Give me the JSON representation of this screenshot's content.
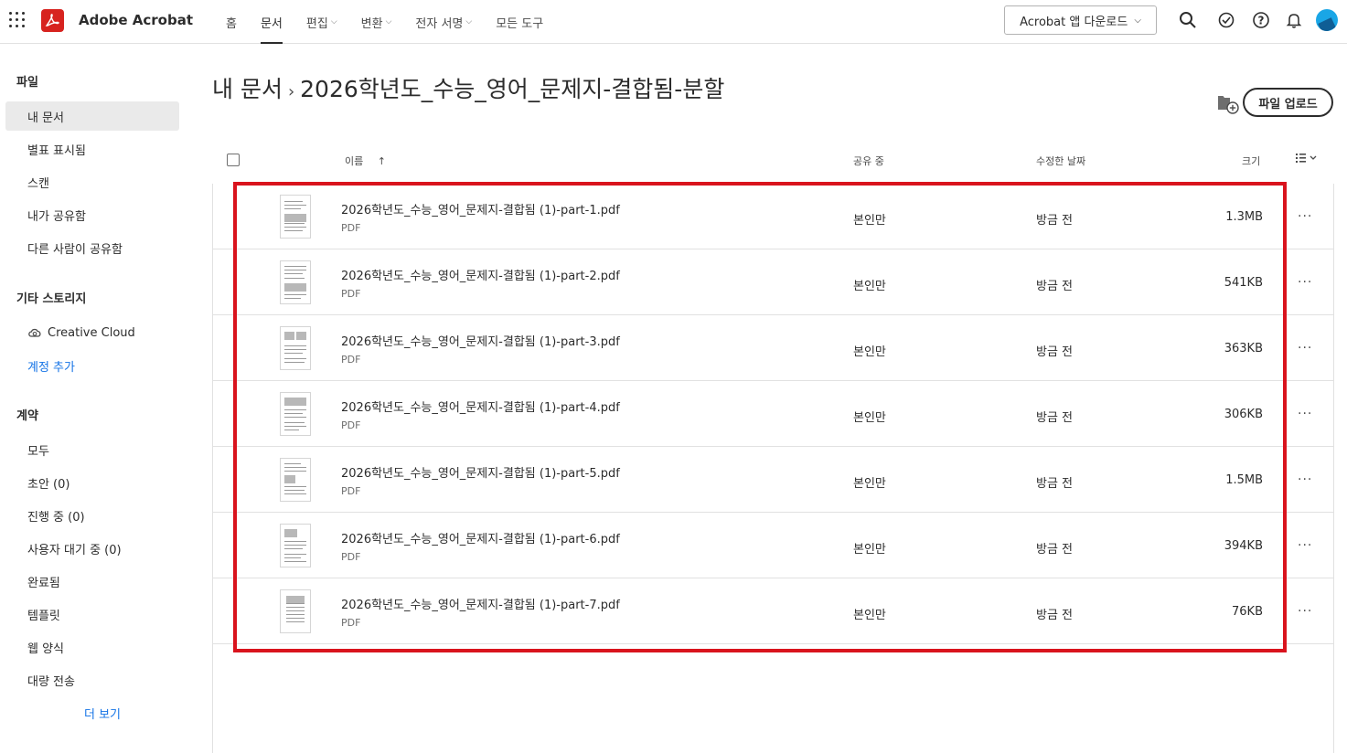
{
  "app": {
    "title": "Adobe Acrobat",
    "brand_color": "#d7231f"
  },
  "nav": [
    {
      "label": "홈",
      "dropdown": false,
      "active": false
    },
    {
      "label": "문서",
      "dropdown": false,
      "active": true
    },
    {
      "label": "편집",
      "dropdown": true,
      "active": false
    },
    {
      "label": "변환",
      "dropdown": true,
      "active": false
    },
    {
      "label": "전자 서명",
      "dropdown": true,
      "active": false
    },
    {
      "label": "모든 도구",
      "dropdown": false,
      "active": false
    }
  ],
  "header": {
    "download_label": "Acrobat 앱 다운로드"
  },
  "sidebar": {
    "files_heading": "파일",
    "files_items": [
      "내 문서",
      "별표 표시됨",
      "스캔",
      "내가 공유함",
      "다른 사람이 공유함"
    ],
    "storage_heading": "기타 스토리지",
    "storage_items": [
      "Creative Cloud"
    ],
    "add_account": "계정 추가",
    "contracts_heading": "계약",
    "contracts_items": [
      "모두",
      "초안 (0)",
      "진행 중 (0)",
      "사용자 대기 중 (0)",
      "완료됨",
      "템플릿",
      "웹 양식",
      "대량 전송"
    ],
    "more_label": "더 보기"
  },
  "main": {
    "breadcrumb_root": "내 문서",
    "breadcrumb_current": "2026학년도_수능_영어_문제지-결합됨-분할",
    "upload_label": "파일 업로드",
    "columns": {
      "name": "이름",
      "shared": "공유 중",
      "modified": "수정한 날짜",
      "size": "크기"
    },
    "files": [
      {
        "name": "2026학년도_수능_영어_문제지-결합됨 (1)-part-1.pdf",
        "type": "PDF",
        "shared": "본인만",
        "modified": "방금 전",
        "size": "1.3MB"
      },
      {
        "name": "2026학년도_수능_영어_문제지-결합됨 (1)-part-2.pdf",
        "type": "PDF",
        "shared": "본인만",
        "modified": "방금 전",
        "size": "541KB"
      },
      {
        "name": "2026학년도_수능_영어_문제지-결합됨 (1)-part-3.pdf",
        "type": "PDF",
        "shared": "본인만",
        "modified": "방금 전",
        "size": "363KB"
      },
      {
        "name": "2026학년도_수능_영어_문제지-결합됨 (1)-part-4.pdf",
        "type": "PDF",
        "shared": "본인만",
        "modified": "방금 전",
        "size": "306KB"
      },
      {
        "name": "2026학년도_수능_영어_문제지-결합됨 (1)-part-5.pdf",
        "type": "PDF",
        "shared": "본인만",
        "modified": "방금 전",
        "size": "1.5MB"
      },
      {
        "name": "2026학년도_수능_영어_문제지-결합됨 (1)-part-6.pdf",
        "type": "PDF",
        "shared": "본인만",
        "modified": "방금 전",
        "size": "394KB"
      },
      {
        "name": "2026학년도_수능_영어_문제지-결합됨 (1)-part-7.pdf",
        "type": "PDF",
        "shared": "본인만",
        "modified": "방금 전",
        "size": "76KB"
      }
    ]
  },
  "annotation": {
    "highlight_color": "#d9131d"
  }
}
